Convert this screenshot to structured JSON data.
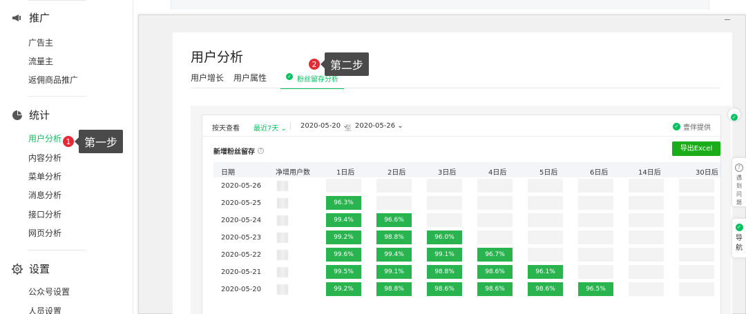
{
  "sidebar": {
    "sections": [
      {
        "title": "推广",
        "icon": "megaphone-icon",
        "items": [
          "广告主",
          "流量主",
          "返佣商品推广"
        ]
      },
      {
        "title": "统计",
        "icon": "pie-chart-icon",
        "items": [
          "用户分析",
          "内容分析",
          "菜单分析",
          "消息分析",
          "接口分析",
          "网页分析"
        ]
      },
      {
        "title": "设置",
        "icon": "gear-icon",
        "items": [
          "公众号设置",
          "人员设置"
        ]
      }
    ],
    "active_item": "用户分析"
  },
  "page": {
    "title": "用户分析",
    "tabs": [
      "用户增长",
      "用户属性",
      "粉丝留存分析"
    ],
    "active_tab": "粉丝留存分析"
  },
  "filter": {
    "label": "按天查看",
    "range": "最近7天",
    "start": "2020-05-20",
    "to": "至",
    "end": "2020-05-26",
    "provider": "壹伴提供"
  },
  "retention": {
    "title": "新增粉丝留存",
    "export_label": "导出Excel",
    "columns": [
      "日期",
      "净增用户数",
      "1日后",
      "2日后",
      "3日后",
      "4日后",
      "5日后",
      "6日后",
      "14日后",
      "30日后"
    ],
    "rows": [
      {
        "date": "2020-05-26",
        "values": []
      },
      {
        "date": "2020-05-25",
        "values": [
          "96.3%"
        ]
      },
      {
        "date": "2020-05-24",
        "values": [
          "99.4%",
          "96.6%"
        ]
      },
      {
        "date": "2020-05-23",
        "values": [
          "99.2%",
          "98.8%",
          "96.0%"
        ]
      },
      {
        "date": "2020-05-22",
        "values": [
          "99.6%",
          "99.4%",
          "99.1%",
          "96.7%"
        ]
      },
      {
        "date": "2020-05-21",
        "values": [
          "99.5%",
          "99.1%",
          "98.8%",
          "98.6%",
          "96.1%"
        ]
      },
      {
        "date": "2020-05-20",
        "values": [
          "99.2%",
          "98.8%",
          "98.6%",
          "98.6%",
          "98.6%",
          "96.5%"
        ]
      }
    ]
  },
  "callouts": {
    "step1": {
      "num": "1",
      "label": "第一步"
    },
    "step2": {
      "num": "2",
      "label": "第二步"
    }
  },
  "floaters": {
    "help": "遇到问题",
    "nav": "导航"
  },
  "colors": {
    "accent": "#07c160",
    "cell_fill": "#2ab44f",
    "callout_badge": "#e52a33",
    "callout_label": "#4a4a4a"
  }
}
